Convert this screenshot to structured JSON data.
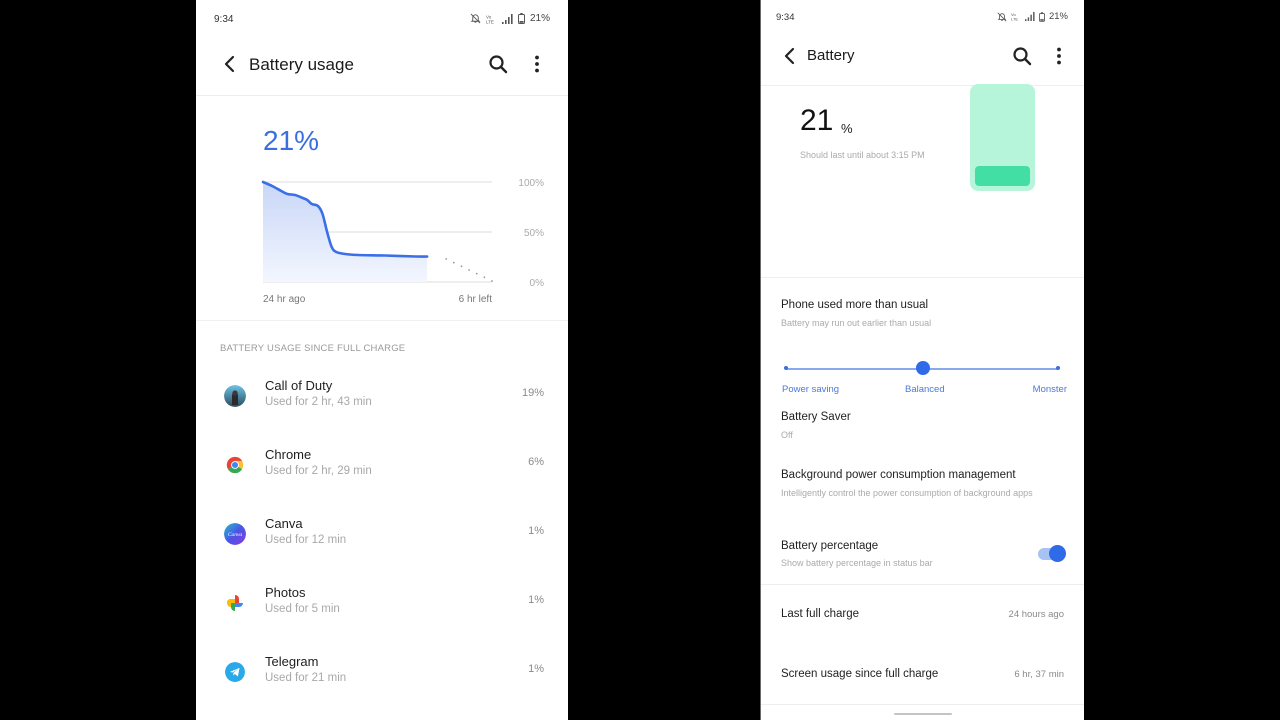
{
  "left_screen": {
    "status_bar": {
      "time": "9:34",
      "battery_text": "21%",
      "icons": [
        "mute-icon",
        "volte-icon",
        "signal-icon",
        "battery-icon"
      ]
    },
    "app_bar": {
      "title": "Battery usage",
      "back_icon": "chevron-left-icon",
      "search_icon": "search-icon",
      "more_icon": "more-vert-icon"
    },
    "battery_level": "21%",
    "section_header": "BATTERY USAGE SINCE FULL CHARGE",
    "apps": [
      {
        "name": "Call of Duty",
        "usage": "Used for 2 hr, 43 min",
        "percent": "19%",
        "icon": "call-of-duty-icon"
      },
      {
        "name": "Chrome",
        "usage": "Used for 2 hr, 29 min",
        "percent": "6%",
        "icon": "chrome-icon"
      },
      {
        "name": "Canva",
        "usage": "Used for 12 min",
        "percent": "1%",
        "icon": "canva-icon"
      },
      {
        "name": "Photos",
        "usage": "Used for 5 min",
        "percent": "1%",
        "icon": "photos-icon"
      },
      {
        "name": "Telegram",
        "usage": "Used for 21 min",
        "percent": "1%",
        "icon": "telegram-icon"
      }
    ]
  },
  "chart_data": {
    "type": "line",
    "title": "",
    "xlabel": "",
    "ylabel": "",
    "x_tick_labels": [
      "24 hr ago",
      "6 hr left"
    ],
    "y_tick_labels": [
      "100%",
      "50%",
      "0%"
    ],
    "ylim": [
      0,
      100
    ],
    "xlim": [
      0,
      30
    ],
    "x_unit": "hours since 24 hr ago",
    "grid": true,
    "series": [
      {
        "name": "battery level",
        "style": "solid-filled",
        "points": [
          [
            0,
            100
          ],
          [
            1.2,
            96
          ],
          [
            2.4,
            91
          ],
          [
            3.2,
            88
          ],
          [
            4.2,
            87
          ],
          [
            5.2,
            84
          ],
          [
            5.8,
            82
          ],
          [
            6.4,
            78
          ],
          [
            7.2,
            76
          ],
          [
            7.8,
            68
          ],
          [
            8.4,
            50
          ],
          [
            9.0,
            35
          ],
          [
            9.6,
            30
          ],
          [
            10.8,
            28
          ],
          [
            12.5,
            27
          ],
          [
            16,
            26.5
          ],
          [
            20,
            25.5
          ],
          [
            21.5,
            25.5
          ]
        ]
      },
      {
        "name": "projected",
        "style": "dotted",
        "points": [
          [
            24,
            23
          ],
          [
            30,
            1
          ]
        ]
      }
    ]
  },
  "right_screen": {
    "status_bar": {
      "time": "9:34",
      "battery_text": "21%",
      "icons": [
        "mute-icon",
        "volte-icon",
        "signal-icon",
        "battery-icon"
      ]
    },
    "app_bar": {
      "title": "Battery",
      "back_icon": "chevron-left-icon",
      "search_icon": "search-icon",
      "more_icon": "more-vert-icon"
    },
    "battery_value": "21",
    "battery_unit": "%",
    "battery_fill_fraction": 0.21,
    "estimate": "Should last until about 3:15 PM",
    "alert": {
      "title": "Phone used more than usual",
      "subtitle": "Battery may run out earlier than usual"
    },
    "mode_slider": {
      "options": [
        "Power saving",
        "Balanced",
        "Monster"
      ],
      "selected": "Balanced"
    },
    "battery_saver": {
      "title": "Battery Saver",
      "value": "Off"
    },
    "background_mgmt": {
      "title": "Background power consumption management",
      "subtitle": "Intelligently control the power consumption of background apps"
    },
    "battery_percentage": {
      "title": "Battery percentage",
      "subtitle": "Show battery percentage in status bar",
      "enabled": true
    },
    "last_full_charge": {
      "label": "Last full charge",
      "value": "24 hours ago"
    },
    "screen_usage": {
      "label": "Screen usage since full charge",
      "value": "6 hr, 37 min"
    },
    "colors": {
      "accent": "#2f6ae8",
      "battery_body": "#b7f5db",
      "battery_fill": "#43dea4"
    }
  }
}
